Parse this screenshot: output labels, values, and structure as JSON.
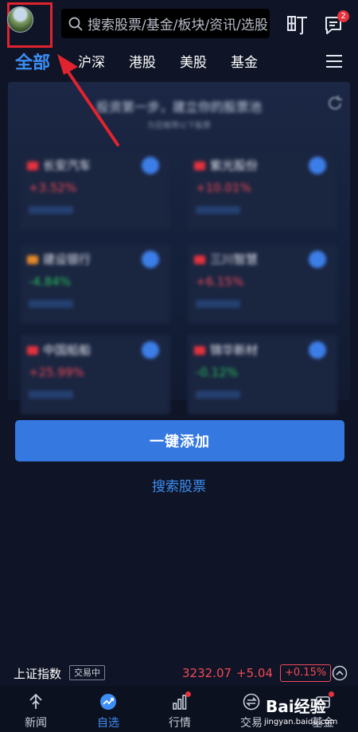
{
  "header": {
    "search_placeholder": "搜索股票/基金/板块/资讯/选股",
    "message_badge": "2"
  },
  "tabs": [
    {
      "label": "全部",
      "active": true
    },
    {
      "label": "沪深",
      "active": false
    },
    {
      "label": "港股",
      "active": false
    },
    {
      "label": "美股",
      "active": false
    },
    {
      "label": "基金",
      "active": false
    }
  ],
  "panel": {
    "title": "投资第一步，建立你的股票池",
    "subtitle": "为您推荐以下股票",
    "stocks": [
      {
        "name": "长安汽车",
        "change": "+3.52%",
        "direction": "up"
      },
      {
        "name": "紫光股份",
        "change": "+10.01%",
        "direction": "up"
      },
      {
        "name": "建设银行",
        "change": "-4.84%",
        "direction": "down"
      },
      {
        "name": "三川智慧",
        "change": "+6.15%",
        "direction": "up"
      },
      {
        "name": "中国船舶",
        "change": "+25.99%",
        "direction": "up"
      },
      {
        "name": "锦华新材",
        "change": "-0.12%",
        "direction": "down"
      }
    ]
  },
  "actions": {
    "one_click_add": "一键添加",
    "search_stocks": "搜索股票"
  },
  "index_ticker": {
    "name": "上证指数",
    "status": "交易中",
    "price": "3232.07",
    "change": "+5.04",
    "change_pct": "+0.15%"
  },
  "bottom_nav": [
    {
      "label": "新闻",
      "icon": "news-icon",
      "active": false
    },
    {
      "label": "自选",
      "icon": "watchlist-icon",
      "active": true
    },
    {
      "label": "行情",
      "icon": "market-icon",
      "active": false
    },
    {
      "label": "交易",
      "icon": "trade-icon",
      "active": false
    },
    {
      "label": "基金",
      "icon": "fund-icon",
      "active": false
    }
  ],
  "watermark": {
    "text": "Bai经验",
    "url": "jingyan.baidu.com"
  },
  "colors": {
    "accent": "#3d8ef5",
    "up": "#f24957",
    "down": "#27c25a",
    "highlight_border": "#e0232f"
  }
}
